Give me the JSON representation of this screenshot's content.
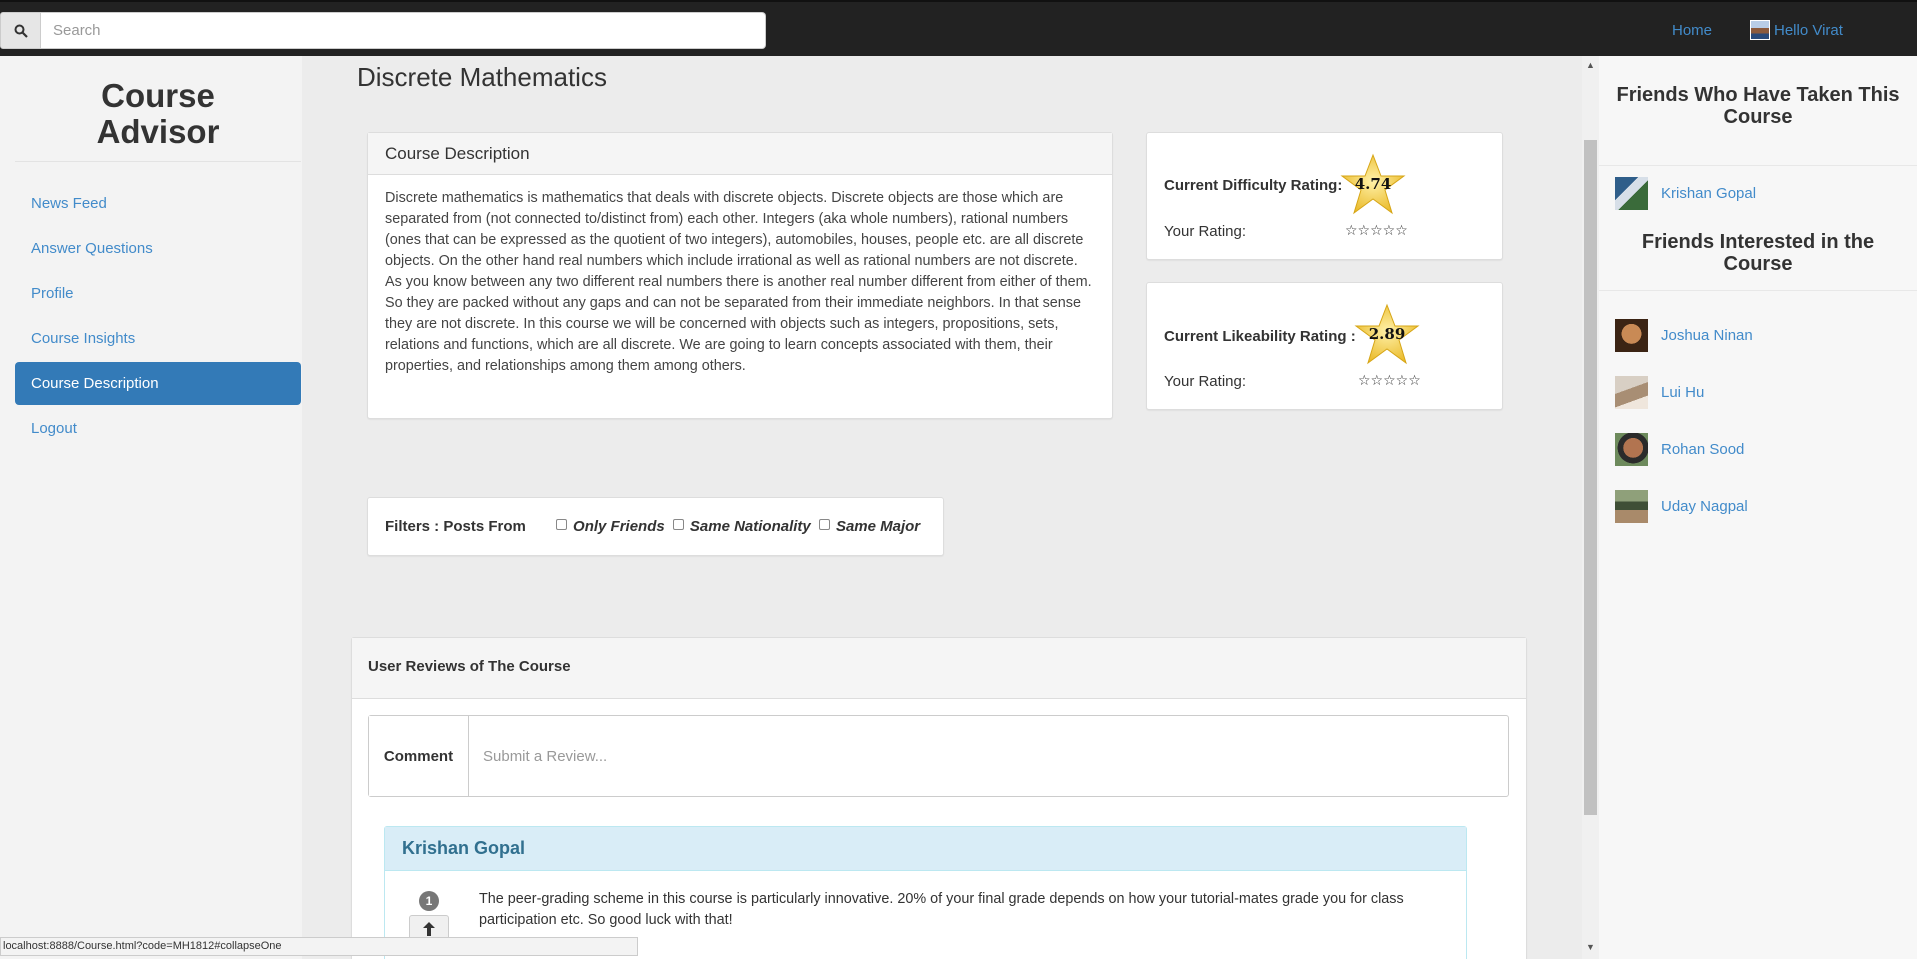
{
  "topbar": {
    "search_placeholder": "Search",
    "home_label": "Home",
    "user_label": "Hello Virat"
  },
  "sidebar": {
    "brand": "Course Advisor",
    "items": [
      {
        "label": "News Feed"
      },
      {
        "label": "Answer Questions"
      },
      {
        "label": "Profile"
      },
      {
        "label": "Course Insights"
      },
      {
        "label": "Course Description",
        "active": true
      },
      {
        "label": "Logout"
      }
    ]
  },
  "main": {
    "title": "Discrete Mathematics",
    "description": {
      "heading": "Course Description",
      "text": "Discrete mathematics is mathematics that deals with discrete objects. Discrete objects are those which are separated from (not connected to/distinct from) each other. Integers (aka whole numbers), rational numbers (ones that can be expressed as the quotient of two integers), automobiles, houses, people etc. are all discrete objects. On the other hand real numbers which include irrational as well as rational numbers are not discrete. As you know between any two different real numbers there is another real number different from either of them. So they are packed without any gaps and can not be separated from their immediate neighbors. In that sense they are not discrete. In this course we will be concerned with objects such as integers, propositions, sets, relations and functions, which are all discrete. We are going to learn concepts associated with them, their properties, and relationships among them among others."
    },
    "difficulty": {
      "label": "Current Difficulty Rating:",
      "value": "4.74",
      "your_rating_label": "Your Rating:",
      "your_rating_stars": "☆☆☆☆☆"
    },
    "likeability": {
      "label": "Current Likeability Rating :",
      "value": "2.89",
      "your_rating_label": "Your Rating:",
      "your_rating_stars": "☆☆☆☆☆"
    },
    "filters": {
      "label": "Filters : Posts From",
      "options": [
        "Only Friends",
        "Same Nationality",
        "Same Major"
      ]
    },
    "reviews": {
      "heading": "User Reviews of The Course",
      "comment_label": "Comment",
      "comment_placeholder": "Submit a Review...",
      "items": [
        {
          "author": "Krishan Gopal",
          "votes": "1",
          "text": "The peer-grading scheme in this course is particularly innovative. 20% of your final grade depends on how your tutorial-mates grade you for class participation etc. So good luck with that!"
        }
      ]
    }
  },
  "rightbar": {
    "taken_heading": "Friends Who Have Taken This Course",
    "taken": [
      {
        "name": "Krishan Gopal"
      }
    ],
    "interested_heading": "Friends Interested in the Course",
    "interested": [
      {
        "name": "Joshua Ninan"
      },
      {
        "name": "Lui Hu"
      },
      {
        "name": "Rohan Sood"
      },
      {
        "name": "Uday Nagpal"
      }
    ]
  },
  "statusbar": {
    "url": "localhost:8888/Course.html?code=MH1812#collapseOne"
  },
  "colors": {
    "link": "#428bca",
    "active_nav": "#337ab7",
    "star_gold": "#f2c94c",
    "review_header": "#d9edf7"
  }
}
